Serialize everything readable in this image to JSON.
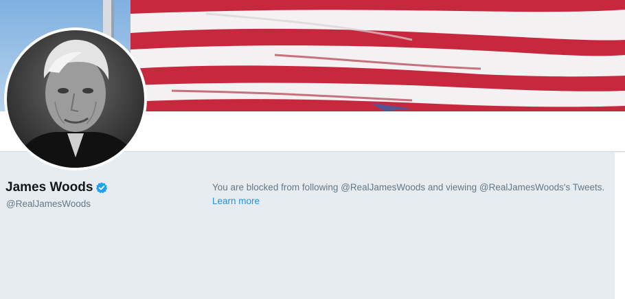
{
  "profile": {
    "display_name": "James Woods",
    "handle": "@RealJamesWoods",
    "verified": true
  },
  "notice": {
    "message": "You are blocked from following @RealJamesWoods and viewing @RealJamesWoods's Tweets.",
    "learn_more": "Learn more"
  },
  "icons": {
    "verified": "verified-badge-icon"
  },
  "colors": {
    "background": "#e6ecf0",
    "link": "#1b95e0",
    "secondary_text": "#657786",
    "primary_text": "#14171a",
    "flag_red": "#c8283e"
  }
}
